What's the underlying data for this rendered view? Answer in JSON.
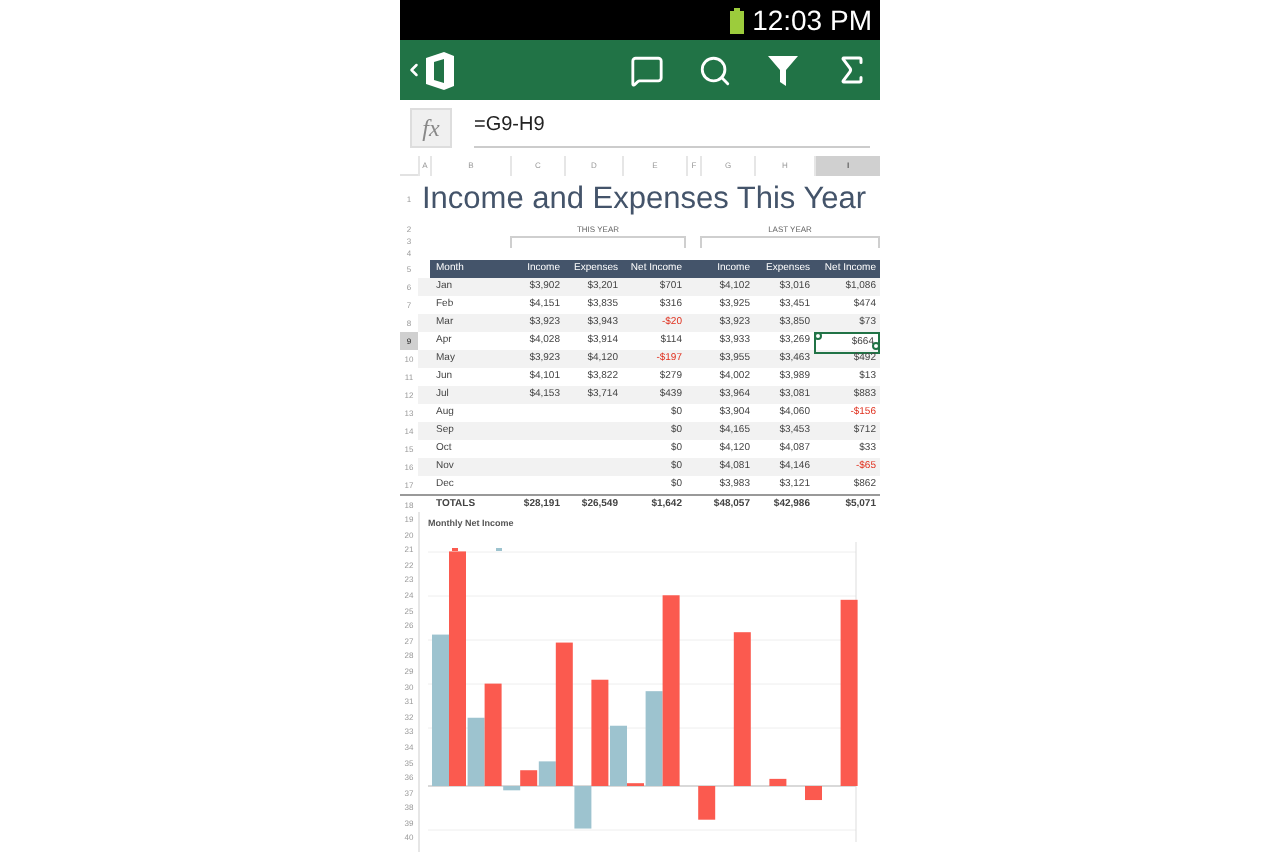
{
  "status_bar": {
    "time": "12:03 PM"
  },
  "formula_bar": {
    "fx": "fx",
    "formula": "=G9-H9"
  },
  "columns": [
    {
      "label": "A",
      "selected": false
    },
    {
      "label": "B",
      "selected": false
    },
    {
      "label": "C",
      "selected": false
    },
    {
      "label": "D",
      "selected": false
    },
    {
      "label": "E",
      "selected": false
    },
    {
      "label": "F",
      "selected": false
    },
    {
      "label": "G",
      "selected": false
    },
    {
      "label": "H",
      "selected": false
    },
    {
      "label": "I",
      "selected": true
    }
  ],
  "sheet": {
    "title_row": "1",
    "title": "Income and Expenses This Year",
    "group_rows": [
      "2",
      "3",
      "4"
    ],
    "groups": [
      "THIS YEAR",
      "LAST YEAR"
    ],
    "header": {
      "row": "5",
      "labels": [
        "Month",
        "Income",
        "Expenses",
        "Net Income",
        "Income",
        "Expenses",
        "Net Income"
      ]
    },
    "rows": [
      {
        "row": "6",
        "selected": false,
        "cells": [
          "Jan",
          "$3,902",
          "$3,201",
          "$701",
          "$4,102",
          "$3,016",
          "$1,086"
        ]
      },
      {
        "row": "7",
        "selected": false,
        "cells": [
          "Feb",
          "$4,151",
          "$3,835",
          "$316",
          "$3,925",
          "$3,451",
          "$474"
        ]
      },
      {
        "row": "8",
        "selected": false,
        "cells": [
          "Mar",
          "$3,923",
          "$3,943",
          {
            "text": "-$20",
            "negative": true
          },
          "$3,923",
          "$3,850",
          "$73"
        ]
      },
      {
        "row": "9",
        "selected": true,
        "cells": [
          "Apr",
          "$4,028",
          "$3,914",
          "$114",
          "$3,933",
          "$3,269",
          "$664"
        ]
      },
      {
        "row": "10",
        "selected": false,
        "cells": [
          "May",
          "$3,923",
          "$4,120",
          {
            "text": "-$197",
            "negative": true
          },
          "$3,955",
          "$3,463",
          "$492"
        ]
      },
      {
        "row": "11",
        "selected": false,
        "cells": [
          "Jun",
          "$4,101",
          "$3,822",
          "$279",
          "$4,002",
          "$3,989",
          "$13"
        ]
      },
      {
        "row": "12",
        "selected": false,
        "cells": [
          "Jul",
          "$4,153",
          "$3,714",
          "$439",
          "$3,964",
          "$3,081",
          "$883"
        ]
      },
      {
        "row": "13",
        "selected": false,
        "cells": [
          "Aug",
          "",
          "",
          "$0",
          "$3,904",
          "$4,060",
          {
            "text": "-$156",
            "negative": true
          }
        ]
      },
      {
        "row": "14",
        "selected": false,
        "cells": [
          "Sep",
          "",
          "",
          "$0",
          "$4,165",
          "$3,453",
          "$712"
        ]
      },
      {
        "row": "15",
        "selected": false,
        "cells": [
          "Oct",
          "",
          "",
          "$0",
          "$4,120",
          "$4,087",
          "$33"
        ]
      },
      {
        "row": "16",
        "selected": false,
        "cells": [
          "Nov",
          "",
          "",
          "$0",
          "$4,081",
          "$4,146",
          {
            "text": "-$65",
            "negative": true
          }
        ]
      },
      {
        "row": "17",
        "selected": false,
        "cells": [
          "Dec",
          "",
          "",
          "$0",
          "$3,983",
          "$3,121",
          "$862"
        ]
      }
    ],
    "totals": {
      "row": "18",
      "cells": [
        "TOTALS",
        "$28,191",
        "$26,549",
        "$1,642",
        "$48,057",
        "$42,986",
        "$5,071"
      ]
    }
  },
  "chart": {
    "title": "Monthly Net Income",
    "rows": [
      "19",
      "20",
      "21",
      "22",
      "23",
      "24",
      "25",
      "26",
      "27",
      "28",
      "29",
      "30",
      "31",
      "32",
      "33",
      "34",
      "35",
      "36",
      "37",
      "38",
      "39",
      "40"
    ]
  }
}
